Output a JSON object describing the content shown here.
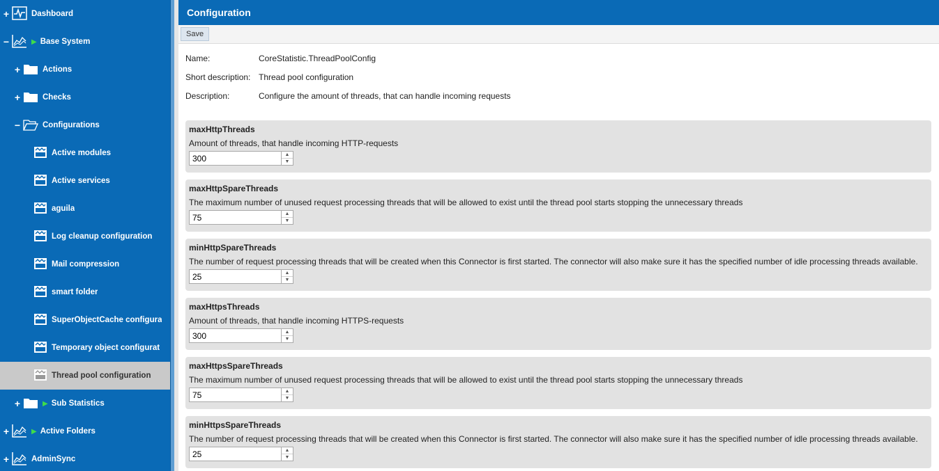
{
  "sidebar": {
    "items": [
      {
        "label": "Dashboard",
        "toggle": "+"
      },
      {
        "label": "Base System",
        "toggle": "−"
      },
      {
        "label": "Actions",
        "toggle": "+"
      },
      {
        "label": "Checks",
        "toggle": "+"
      },
      {
        "label": "Configurations",
        "toggle": "−"
      },
      {
        "label": "Active modules"
      },
      {
        "label": "Active services"
      },
      {
        "label": "aguila"
      },
      {
        "label": "Log cleanup configuration"
      },
      {
        "label": "Mail compression"
      },
      {
        "label": "smart folder"
      },
      {
        "label": "SuperObjectCache configura"
      },
      {
        "label": "Temporary object configurat"
      },
      {
        "label": "Thread pool configuration"
      },
      {
        "label": "Sub Statistics",
        "toggle": "+"
      },
      {
        "label": "Active Folders",
        "toggle": "+"
      },
      {
        "label": "AdminSync",
        "toggle": "+"
      }
    ]
  },
  "header": {
    "title": "Configuration"
  },
  "toolbar": {
    "save_label": "Save"
  },
  "meta": {
    "name_label": "Name:",
    "name_value": "CoreStatistic.ThreadPoolConfig",
    "short_label": "Short description:",
    "short_value": "Thread pool configuration",
    "desc_label": "Description:",
    "desc_value": "Configure the amount of threads, that can handle incoming requests"
  },
  "params": [
    {
      "name": "maxHttpThreads",
      "description": "Amount of threads, that handle incoming HTTP-requests",
      "value": "300"
    },
    {
      "name": "maxHttpSpareThreads",
      "description": "The maximum number of unused request processing threads that will be allowed to exist until the thread pool starts stopping the unnecessary threads",
      "value": "75"
    },
    {
      "name": "minHttpSpareThreads",
      "description": "The number of request processing threads that will be created when this Connector is first started. The connector will also make sure it has the specified number of idle processing threads available.",
      "value": "25"
    },
    {
      "name": "maxHttpsThreads",
      "description": "Amount of threads, that handle incoming HTTPS-requests",
      "value": "300"
    },
    {
      "name": "maxHttpsSpareThreads",
      "description": "The maximum number of unused request processing threads that will be allowed to exist until the thread pool starts stopping the unnecessary threads",
      "value": "75"
    },
    {
      "name": "minHttpsSpareThreads",
      "description": "The number of request processing threads that will be created when this Connector is first started. The connector will also make sure it has the specified number of idle processing threads available.",
      "value": "25"
    }
  ],
  "colors": {
    "brand": "#0a6ab6",
    "selected": "#c9c9c9",
    "panel": "#e2e2e2",
    "play": "#3fdc4a"
  }
}
